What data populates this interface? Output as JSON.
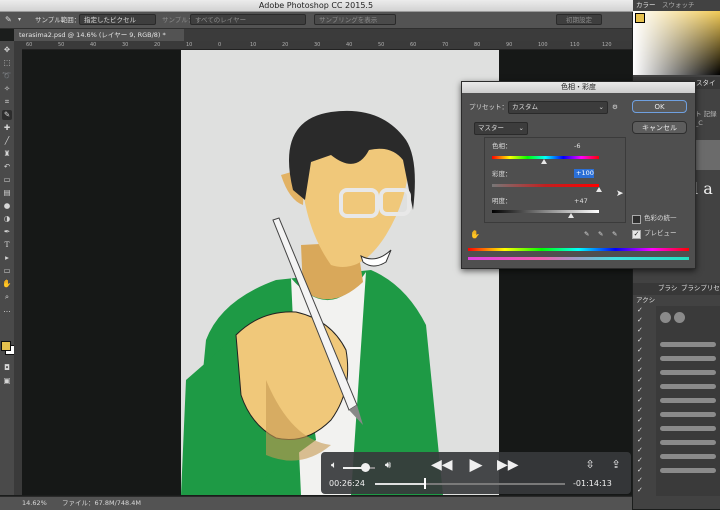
{
  "app": {
    "title": "Adobe Photoshop CC 2015.5"
  },
  "options": {
    "sample_size_label": "サンプル範囲：",
    "sample_size_value": "指定したピクセル",
    "sample_label": "サンプル：",
    "sample_value": "すべてのレイヤー",
    "show_ring": "サンプリングを表示",
    "reset": "初期設定"
  },
  "document": {
    "tab_label": "terasima2.psd @ 14.6% (レイヤー 9, RGB/8) *"
  },
  "ruler": {
    "ticks": [
      "60",
      "50",
      "40",
      "30",
      "20",
      "10",
      "0",
      "10",
      "20",
      "30",
      "40",
      "50",
      "60",
      "70",
      "80",
      "90",
      "100",
      "110",
      "120"
    ]
  },
  "status": {
    "zoom": "14.62%",
    "file_info": "ファイル：67.8M/748.4M"
  },
  "panels": {
    "color_tab": "カラー",
    "swatch_tab": "スウォッチ",
    "style_tab": "スタイ",
    "brush_tab": "ブラシ",
    "brush_preset_tab": "ブラシプリセ",
    "actions_label": "アクシ",
    "type_preview": "l a",
    "layer_hint": "ト 記録_C"
  },
  "dialog": {
    "title": "色相・彩度",
    "preset_label": "プリセット：",
    "preset_value": "カスタム",
    "channel_value": "マスター",
    "hue_label": "色相：",
    "hue_value": "-6",
    "saturation_label": "彩度：",
    "saturation_value": "+100",
    "lightness_label": "明度：",
    "lightness_value": "+47",
    "ok_label": "OK",
    "cancel_label": "キャンセル",
    "colorize_label": "色彩の統一",
    "preview_label": "プレビュー",
    "colorize_checked": false,
    "preview_checked": true,
    "hue_level": -6,
    "saturation_level": 100,
    "lightness_level": 47
  },
  "video": {
    "elapsed": "00:26:24",
    "remaining": "-01:14:13",
    "progress": 0.26,
    "volume": 0.7
  },
  "colors": {
    "foreground": "#e6c14e",
    "accent_blue": "#2b6fd6",
    "shirt_green": "#1e9a45",
    "skin": "#f0c87a"
  }
}
